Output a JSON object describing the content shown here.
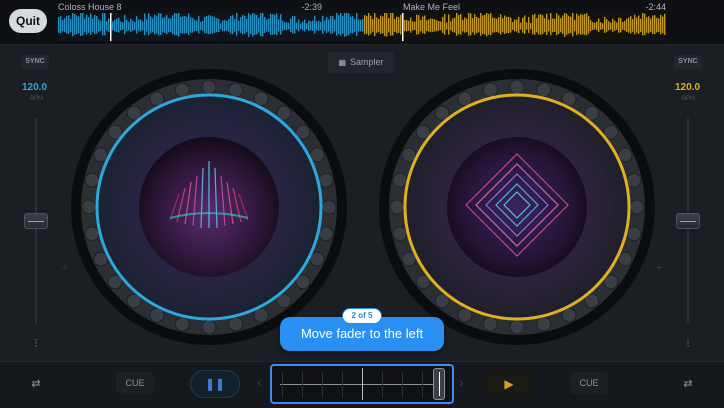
{
  "topbar": {
    "quit_label": "Quit",
    "deck_a": {
      "title": "Coloss House 8",
      "time": "-2:39"
    },
    "deck_b": {
      "title": "Make Me Feel",
      "time": "-2:44"
    }
  },
  "colors": {
    "deck_a_accent": "#2aa8e0",
    "deck_b_accent": "#e0b020",
    "tooltip_bg": "#2a8ff2",
    "crossfader_highlight": "#3b8df0"
  },
  "deck_a": {
    "sync_label": "SYNC",
    "bpm": "120.0",
    "bpm_unit": "BPM",
    "cue_label": "CUE",
    "pitch_fraction": 0.5
  },
  "deck_b": {
    "sync_label": "SYNC",
    "bpm": "120.0",
    "bpm_unit": "BPM",
    "cue_label": "CUE",
    "pitch_fraction": 0.5
  },
  "center": {
    "sampler_label": "Sampler"
  },
  "tutorial": {
    "step": "2 of 5",
    "message": "Move fader to the left"
  },
  "transport": {
    "pause_icon": "pause-icon",
    "play_icon": "play-icon"
  },
  "crossfader": {
    "position_fraction": 0.96
  },
  "icons": {
    "equalizer": "equalizer-icon",
    "settings_sliders": "sliders-icon",
    "sampler": "grid-icon"
  }
}
